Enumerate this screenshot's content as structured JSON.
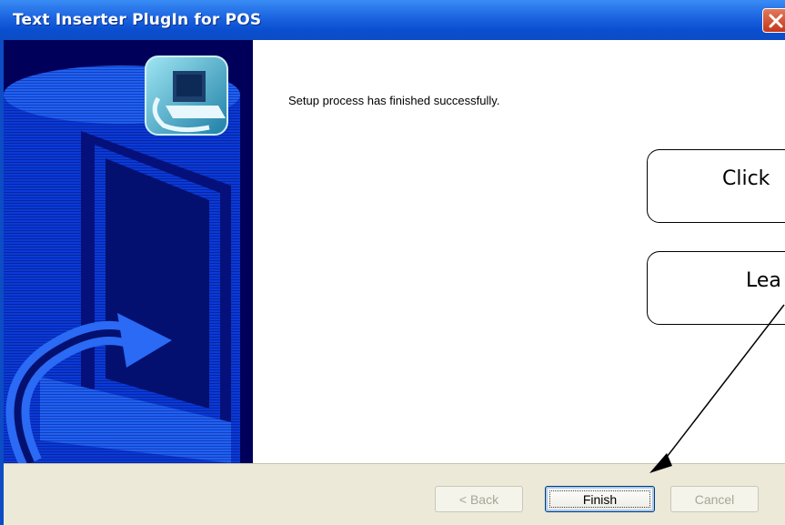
{
  "window": {
    "title": "Text Inserter PlugIn for POS",
    "title_bar_color": "#0c4cc4",
    "close_icon": "close-icon"
  },
  "main": {
    "message": "Setup process has finished successfully."
  },
  "callouts": [
    {
      "text": "Click"
    },
    {
      "text": "Lea"
    }
  ],
  "buttons": {
    "back_label": "< Back",
    "finish_label": "Finish",
    "cancel_label": "Cancel"
  },
  "side_panel": {
    "graphic": "setup-computer-graphic",
    "background_color": "#00005a"
  }
}
